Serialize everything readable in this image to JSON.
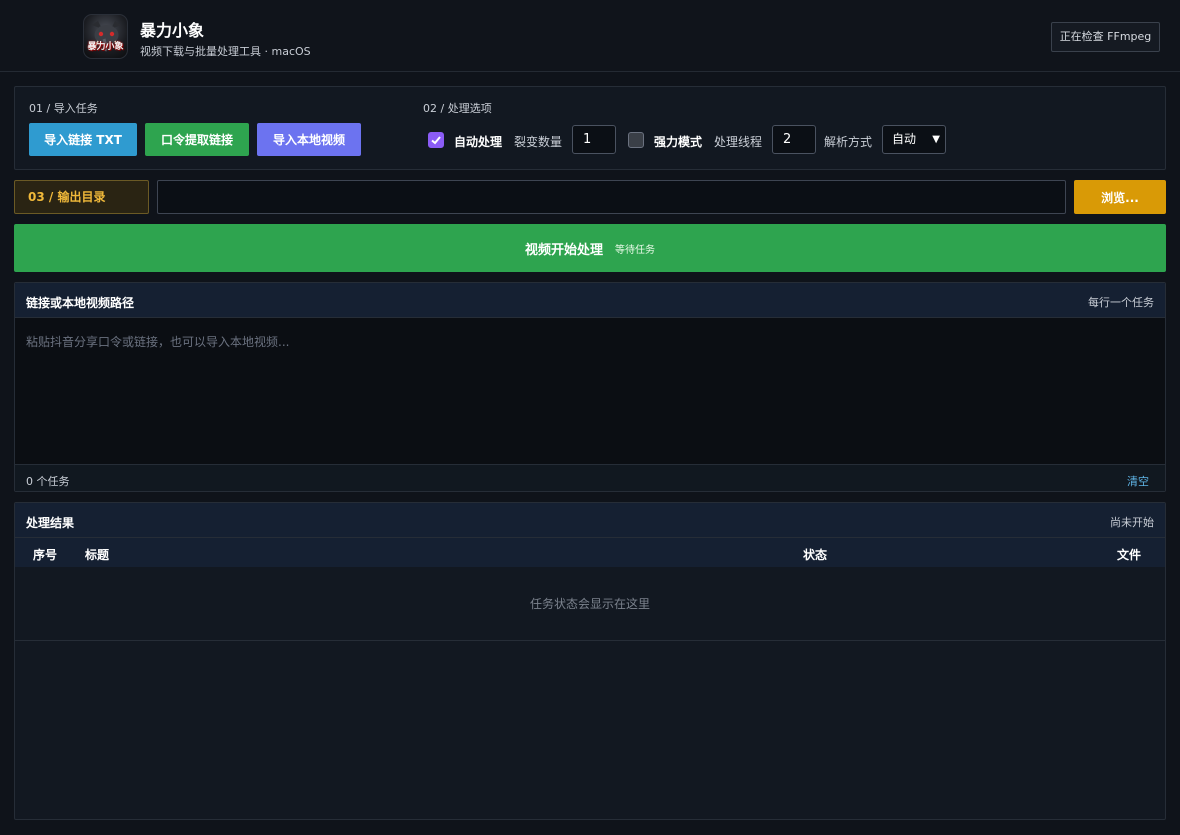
{
  "header": {
    "logo_text": "暴力小象",
    "title": "暴力小象",
    "subtitle": "视频下载与批量处理工具 · macOS",
    "ffmpeg_status": "正在检查 FFmpeg"
  },
  "import_section": {
    "label": "01 / 导入任务",
    "buttons": [
      "导入链接 TXT",
      "口令提取链接",
      "导入本地视频"
    ]
  },
  "options_section": {
    "label": "02 / 处理选项",
    "auto_process": {
      "label": "自动处理",
      "checked": true
    },
    "fission_count": {
      "label": "裂变数量",
      "value": "1"
    },
    "strong_mode": {
      "label": "强力模式",
      "checked": false
    },
    "threads": {
      "label": "处理线程",
      "value": "2"
    },
    "parse_mode": {
      "label": "解析方式",
      "selected": "自动"
    }
  },
  "output_section": {
    "label": "03 / 输出目录",
    "path_value": "",
    "browse_label": "浏览..."
  },
  "start": {
    "label": "视频开始处理",
    "status": "等待任务"
  },
  "links_panel": {
    "title": "链接或本地视频路径",
    "hint": "每行一个任务",
    "placeholder": "粘贴抖音分享口令或链接，也可以导入本地视频...",
    "task_count": "0 个任务",
    "clear_label": "清空"
  },
  "results_panel": {
    "title": "处理结果",
    "status": "尚未开始",
    "columns": [
      "序号",
      "标题",
      "状态",
      "文件"
    ],
    "empty_message": "任务状态会显示在这里"
  },
  "colors": {
    "background": "#0f131a",
    "blue_button": "#2f9bd0",
    "green_button": "#2ea44f",
    "purple_button": "#6c73f0",
    "browse_button": "#d99a06",
    "checkbox_checked": "#8b5cf6",
    "output_label": "#f0b93a"
  }
}
